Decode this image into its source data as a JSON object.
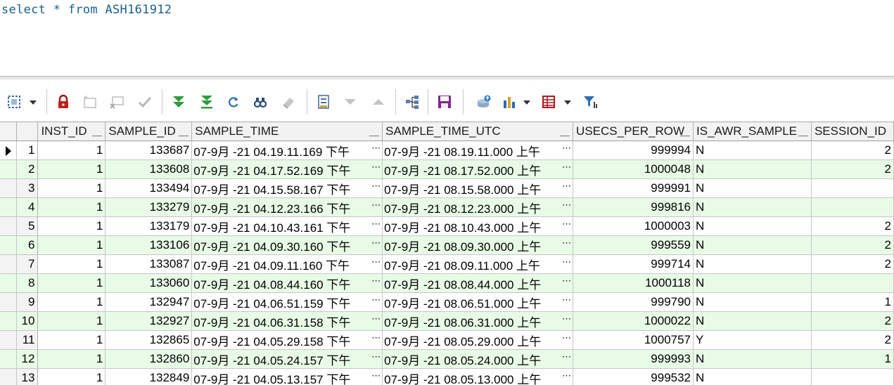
{
  "editor": {
    "sql": "select * from ASH161912"
  },
  "toolbar": {
    "icons": [
      "select-mode-icon",
      "lock-icon",
      "insert-record-icon",
      "delete-record-icon",
      "post-edit-icon",
      "fetch-next-icon",
      "fetch-last-icon",
      "refresh-icon",
      "find-icon",
      "clear-icon",
      "single-record-view-icon",
      "next-record-icon",
      "previous-record-icon",
      "query-by-example-icon",
      "save-icon",
      "export-icon",
      "chart-icon",
      "grid-options-icon",
      "filter-icon"
    ]
  },
  "grid": {
    "columns": [
      "INST_ID",
      "SAMPLE_ID",
      "SAMPLE_TIME",
      "SAMPLE_TIME_UTC",
      "USECS_PER_ROW",
      "IS_AWR_SAMPLE",
      "SESSION_ID"
    ],
    "rows": [
      {
        "n": "1",
        "inst": "1",
        "sample": "133687",
        "time": "07-9月 -21 04.19.11.169 下午",
        "utc": "07-9月 -21 08.19.11.000 上午",
        "usecs": "999994",
        "awr": "N",
        "sess": "2"
      },
      {
        "n": "2",
        "inst": "1",
        "sample": "133608",
        "time": "07-9月 -21 04.17.52.169 下午",
        "utc": "07-9月 -21 08.17.52.000 上午",
        "usecs": "1000048",
        "awr": "N",
        "sess": "2"
      },
      {
        "n": "3",
        "inst": "1",
        "sample": "133494",
        "time": "07-9月 -21 04.15.58.167 下午",
        "utc": "07-9月 -21 08.15.58.000 上午",
        "usecs": "999991",
        "awr": "N",
        "sess": ""
      },
      {
        "n": "4",
        "inst": "1",
        "sample": "133279",
        "time": "07-9月 -21 04.12.23.166 下午",
        "utc": "07-9月 -21 08.12.23.000 上午",
        "usecs": "999816",
        "awr": "N",
        "sess": ""
      },
      {
        "n": "5",
        "inst": "1",
        "sample": "133179",
        "time": "07-9月 -21 04.10.43.161 下午",
        "utc": "07-9月 -21 08.10.43.000 上午",
        "usecs": "1000003",
        "awr": "N",
        "sess": "2"
      },
      {
        "n": "6",
        "inst": "1",
        "sample": "133106",
        "time": "07-9月 -21 04.09.30.160 下午",
        "utc": "07-9月 -21 08.09.30.000 上午",
        "usecs": "999559",
        "awr": "N",
        "sess": "2"
      },
      {
        "n": "7",
        "inst": "1",
        "sample": "133087",
        "time": "07-9月 -21 04.09.11.160 下午",
        "utc": "07-9月 -21 08.09.11.000 上午",
        "usecs": "999714",
        "awr": "N",
        "sess": "2"
      },
      {
        "n": "8",
        "inst": "1",
        "sample": "133060",
        "time": "07-9月 -21 04.08.44.160 下午",
        "utc": "07-9月 -21 08.08.44.000 上午",
        "usecs": "1000118",
        "awr": "N",
        "sess": ""
      },
      {
        "n": "9",
        "inst": "1",
        "sample": "132947",
        "time": "07-9月 -21 04.06.51.159 下午",
        "utc": "07-9月 -21 08.06.51.000 上午",
        "usecs": "999790",
        "awr": "N",
        "sess": "1"
      },
      {
        "n": "10",
        "inst": "1",
        "sample": "132927",
        "time": "07-9月 -21 04.06.31.158 下午",
        "utc": "07-9月 -21 08.06.31.000 上午",
        "usecs": "1000022",
        "awr": "N",
        "sess": "2"
      },
      {
        "n": "11",
        "inst": "1",
        "sample": "132865",
        "time": "07-9月 -21 04.05.29.158 下午",
        "utc": "07-9月 -21 08.05.29.000 上午",
        "usecs": "1000757",
        "awr": "Y",
        "sess": "2"
      },
      {
        "n": "12",
        "inst": "1",
        "sample": "132860",
        "time": "07-9月 -21 04.05.24.157 下午",
        "utc": "07-9月 -21 08.05.24.000 上午",
        "usecs": "999993",
        "awr": "N",
        "sess": "1"
      },
      {
        "n": "13",
        "inst": "1",
        "sample": "132849",
        "time": "07-9月 -21 04.05.13.157 下午",
        "utc": "07-9月 -21 08.05.13.000 上午",
        "usecs": "999532",
        "awr": "N",
        "sess": ""
      }
    ]
  },
  "colors": {
    "alt_row": "#e8fbe6",
    "sql_text": "#1b5f8a",
    "header_bg": "#f2f2f2"
  }
}
